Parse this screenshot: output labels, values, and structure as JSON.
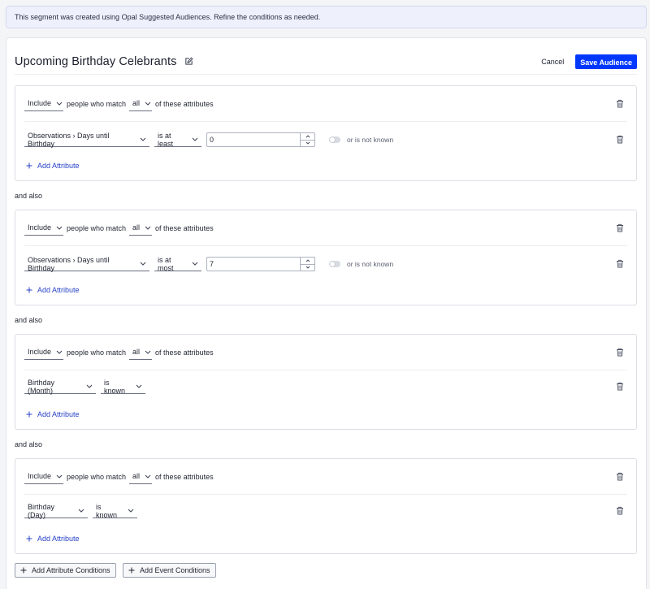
{
  "banner": {
    "text": "This segment was created using Opal Suggested Audiences. Refine the conditions as needed."
  },
  "header": {
    "title": "Upcoming Birthday Celebrants",
    "cancel_label": "Cancel",
    "save_label": "Save Audience"
  },
  "common": {
    "people_who_match": "people who match",
    "of_these_attributes": "of these attributes",
    "add_attribute": "Add Attribute",
    "and_also": "and also",
    "or_is_not_known": "or is not known"
  },
  "groups": [
    {
      "include": "Include",
      "match": "all",
      "attribute": "Observations › Days until Birthday",
      "operator": "is at least",
      "value": "0",
      "has_value": true
    },
    {
      "include": "Include",
      "match": "all",
      "attribute": "Observations › Days until Birthday",
      "operator": "is at most",
      "value": "7",
      "has_value": true
    },
    {
      "include": "Include",
      "match": "all",
      "attribute": "Birthday (Month)",
      "operator": "is known",
      "has_value": false
    },
    {
      "include": "Include",
      "match": "all",
      "attribute": "Birthday (Day)",
      "operator": "is known",
      "has_value": false
    }
  ],
  "footer": {
    "add_attribute_conditions": "Add Attribute Conditions",
    "add_event_conditions": "Add Event Conditions"
  },
  "colors": {
    "primary": "#0037ff",
    "link": "#2742c7",
    "banner_bg": "#eef0fb"
  },
  "icons": {
    "edit": "pencil-square-icon",
    "delete": "trash-icon",
    "dropdown": "chevron-down-icon",
    "add": "plus-icon"
  }
}
